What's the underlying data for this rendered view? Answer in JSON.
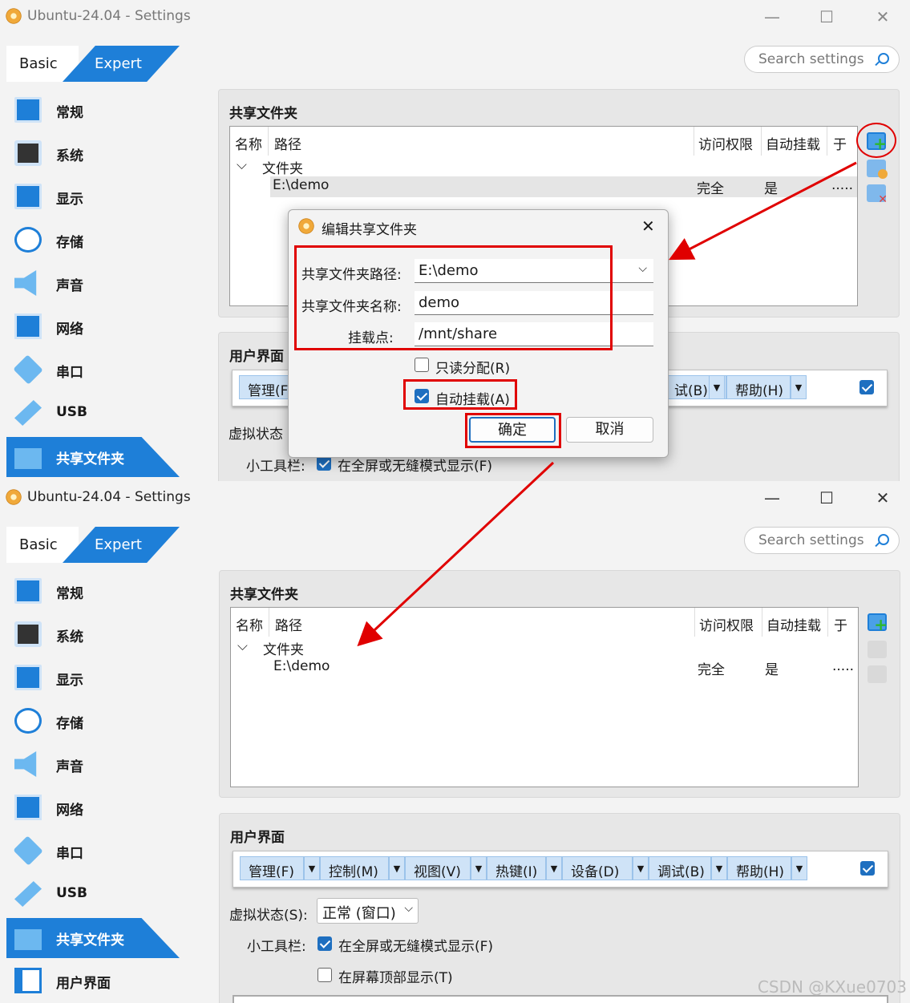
{
  "window": {
    "title": "Ubuntu-24.04 - Settings",
    "minimize": "—",
    "maximize": "☐",
    "close": "✕"
  },
  "mode_tabs": {
    "basic": "Basic",
    "expert": "Expert"
  },
  "search": {
    "placeholder": "Search settings"
  },
  "sidebar": {
    "items": [
      {
        "label": "常规",
        "icon": "monitor-icon"
      },
      {
        "label": "系统",
        "icon": "chip-icon"
      },
      {
        "label": "显示",
        "icon": "display-icon"
      },
      {
        "label": "存储",
        "icon": "disk-icon"
      },
      {
        "label": "声音",
        "icon": "speaker-icon"
      },
      {
        "label": "网络",
        "icon": "network-icon"
      },
      {
        "label": "串口",
        "icon": "serial-icon"
      },
      {
        "label": "USB",
        "icon": "usb-icon"
      },
      {
        "label": "共享文件夹",
        "icon": "shared-folder-icon"
      },
      {
        "label": "用户界面",
        "icon": "user-interface-icon"
      }
    ],
    "selected": "共享文件夹"
  },
  "shared_folders": {
    "title": "共享文件夹",
    "columns": [
      "名称",
      "路径",
      "访问权限",
      "自动挂载",
      "于"
    ],
    "group": "文件夹",
    "rows": [
      {
        "name": "E:\\demo",
        "access": "完全",
        "automount": "是",
        "at": "....."
      }
    ]
  },
  "user_interface": {
    "title": "用户界面",
    "menus": [
      "管理(F)",
      "控制(M)",
      "视图(V)",
      "热键(I)",
      "设备(D)",
      "调试(B)",
      "帮助(H)"
    ],
    "menus_top_visible": [
      "管理(F",
      "试(B)",
      "帮助(H)"
    ],
    "vm_state_label": "虚拟状态(S):",
    "vm_state_label_top": "虚拟状态",
    "vm_state_value": "正常 (窗口)",
    "mini_toolbar_label": "小工具栏:",
    "mini_opt1": "在全屏或无缝模式显示(F)",
    "mini_opt2": "在屏幕顶部显示(T)"
  },
  "dialog": {
    "title": "编辑共享文件夹",
    "path_label": "共享文件夹路径:",
    "path_value": "E:\\demo",
    "name_label": "共享文件夹名称:",
    "name_value": "demo",
    "mount_label": "挂载点:",
    "mount_value": "/mnt/share",
    "readonly_label": "只读分配(R)",
    "readonly_checked": false,
    "automount_label": "自动挂载(A)",
    "automount_checked": true,
    "ok": "确定",
    "cancel": "取消"
  },
  "annotation_color": "#e00000",
  "accent_color": "#1e7fd8",
  "watermark": "CSDN @KXue0703"
}
